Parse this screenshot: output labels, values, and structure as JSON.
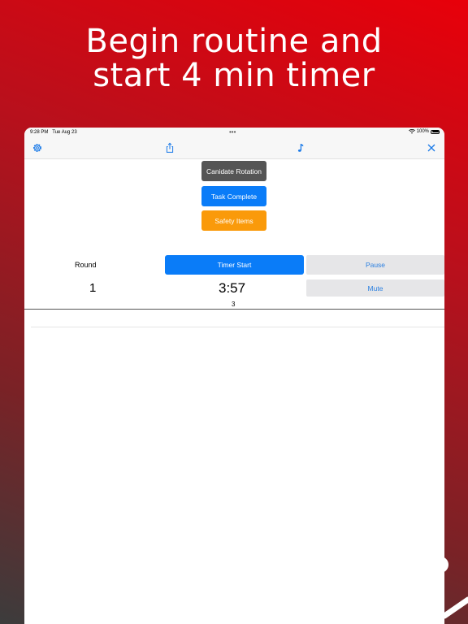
{
  "headline": {
    "line1": "Begin routine and",
    "line2": "start 4 min timer"
  },
  "status_bar": {
    "time": "9:28 PM",
    "date": "Tue Aug 23",
    "dots": "•••",
    "battery": "100%"
  },
  "toolbar": {
    "icons": [
      "gear-icon",
      "share-icon",
      "music-note-icon",
      "close-icon"
    ]
  },
  "buttons": {
    "candidate_rotation": "Canidate Rotation",
    "task_complete": "Task Complete",
    "safety_items": "Safety Items",
    "timer_start": "Timer Start",
    "pause": "Pause",
    "mute": "Mute"
  },
  "scoreboard": {
    "round_label": "Round",
    "round_value": "1",
    "timer_value": "3:57",
    "sub_value": "3"
  },
  "colors": {
    "accent_blue": "#0a7cf8",
    "orange": "#fa9a0a",
    "dark_gray": "#555555",
    "background_red": "#e8000a"
  }
}
